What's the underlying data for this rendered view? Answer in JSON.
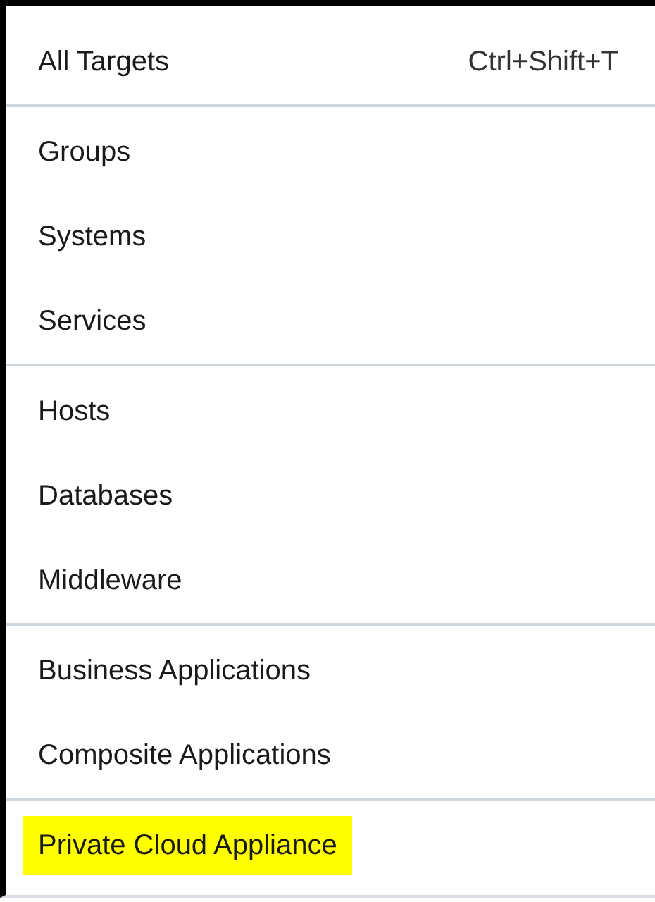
{
  "menu": {
    "sections": [
      {
        "items": [
          {
            "label": "All Targets",
            "shortcut": "Ctrl+Shift+T",
            "highlighted": false
          }
        ]
      },
      {
        "items": [
          {
            "label": "Groups",
            "highlighted": false
          },
          {
            "label": "Systems",
            "highlighted": false
          },
          {
            "label": "Services",
            "highlighted": false
          }
        ]
      },
      {
        "items": [
          {
            "label": "Hosts",
            "highlighted": false
          },
          {
            "label": "Databases",
            "highlighted": false
          },
          {
            "label": "Middleware",
            "highlighted": false
          }
        ]
      },
      {
        "items": [
          {
            "label": "Business Applications",
            "highlighted": false
          },
          {
            "label": "Composite Applications",
            "highlighted": false
          }
        ]
      },
      {
        "items": [
          {
            "label": "Private Cloud Appliance",
            "highlighted": true
          }
        ]
      }
    ]
  }
}
